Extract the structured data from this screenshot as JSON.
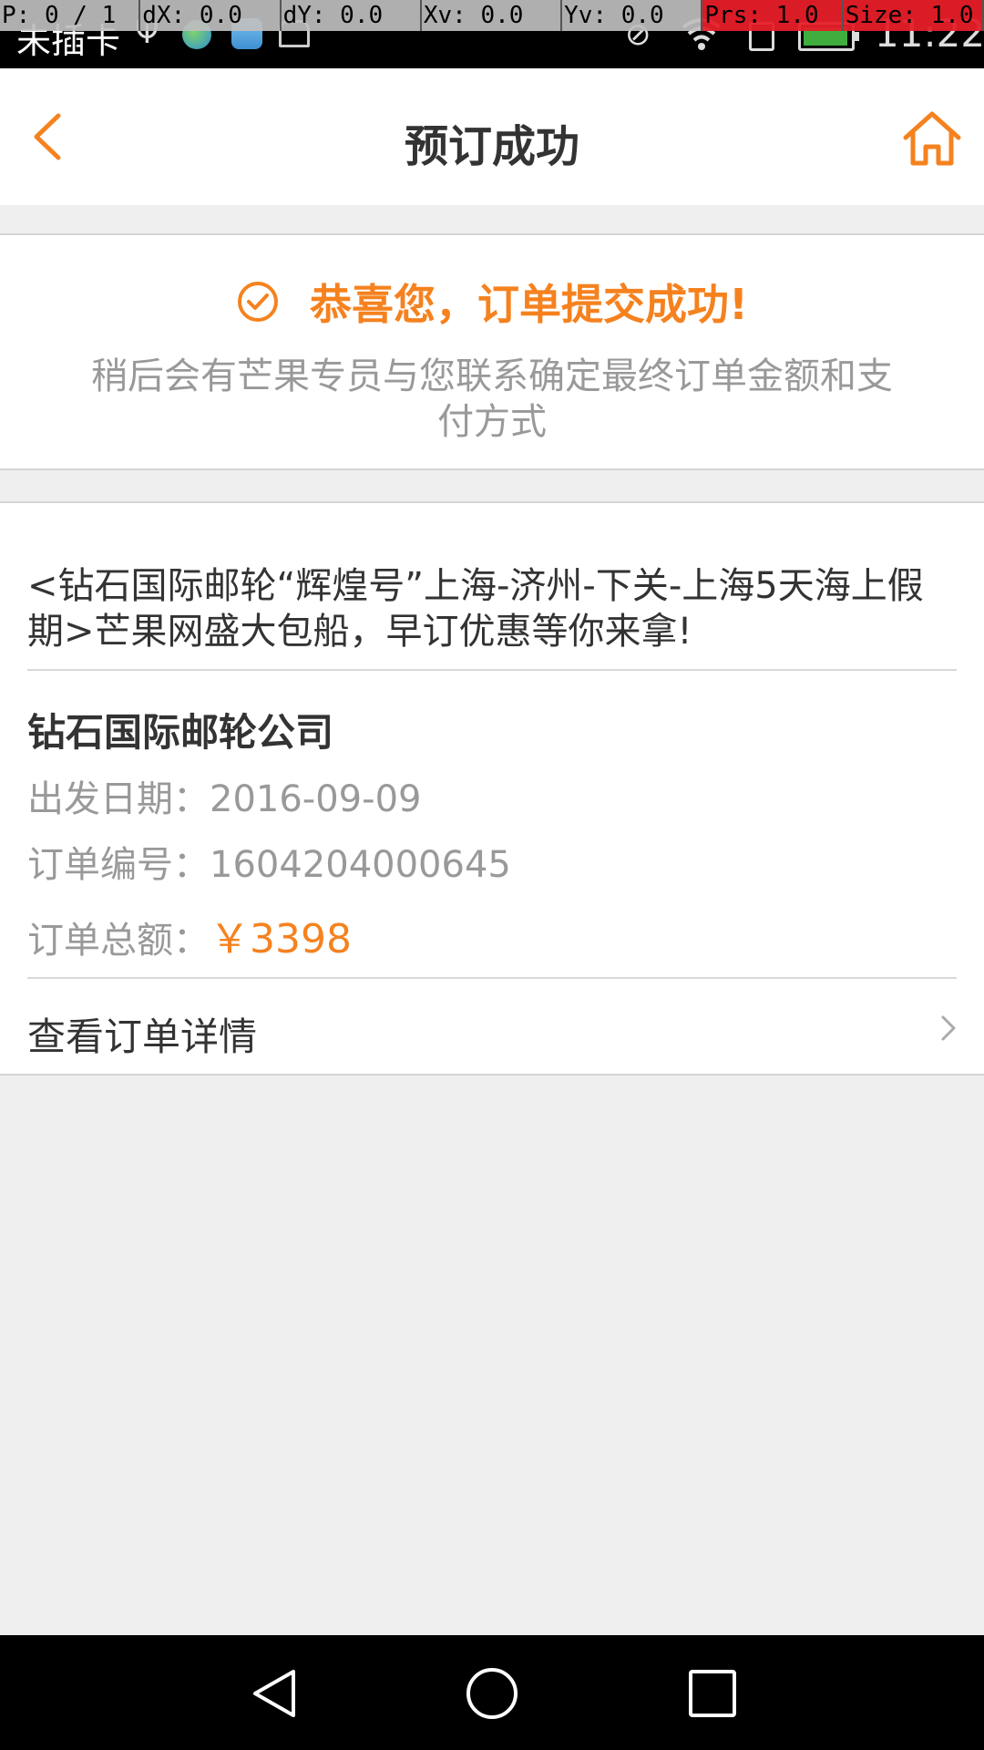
{
  "status_bar": {
    "carrier": "未插卡",
    "time": "11:22",
    "icons": [
      "usb-icon",
      "app-globe-icon",
      "app-health-icon",
      "app-bag-icon",
      "mute-icon",
      "wifi-icon",
      "sim-icon",
      "battery-icon"
    ]
  },
  "debug_overlay": {
    "pointer": "P: 0 / 1",
    "dx": "dX: 0.0",
    "dy": "dY: 0.0",
    "xv": "Xv: 0.0",
    "yv": "Yv: 0.0",
    "prs": "Prs: 1.0",
    "size": "Size: 1.0"
  },
  "header": {
    "title": "预订成功",
    "back_icon": "chevron-left-icon",
    "home_icon": "home-icon"
  },
  "success": {
    "message": "恭喜您，订单提交成功!",
    "sub_message": "稍后会有芒果专员与您联系确定最终订单金额和支付方式"
  },
  "order": {
    "product_title": "<钻石国际邮轮“辉煌号”上海-济州-下关-上海5天海上假期>芒果网盛大包船，早订优惠等你来拿!",
    "company": "钻石国际邮轮公司",
    "departure_label": "出发日期：",
    "departure_value": "2016-09-09",
    "order_no_label": "订单编号：",
    "order_no_value": "1604204000645",
    "total_label": "订单总额：",
    "total_value": "￥3398",
    "detail_link": "查看订单详情"
  },
  "colors": {
    "accent": "#f5821f",
    "background": "#efefef",
    "text_primary": "#333333",
    "text_secondary": "#999999"
  }
}
